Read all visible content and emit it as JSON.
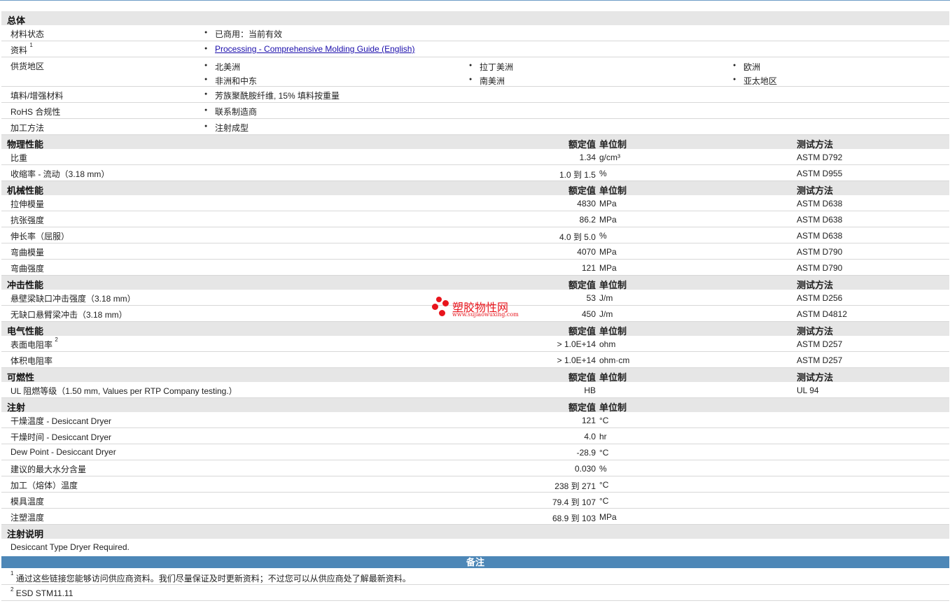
{
  "general": {
    "title": "总体",
    "material_status": {
      "label": "材料状态",
      "value": "已商用：当前有效"
    },
    "resources": {
      "label": "资料",
      "sup": "1",
      "link": "Processing - Comprehensive Molding Guide (English)"
    },
    "availability": {
      "label": "供货地区",
      "regions": [
        "北美洲",
        "拉丁美洲",
        "欧洲",
        "非洲和中东",
        "南美洲",
        "亚太地区"
      ]
    },
    "filler": {
      "label": "填料/增强材料",
      "value": "芳族聚酰胺纤维, 15% 填料按重量"
    },
    "rohs": {
      "label": "RoHS 合规性",
      "value": "联系制造商"
    },
    "processing": {
      "label": "加工方法",
      "value": "注射成型"
    }
  },
  "headers": {
    "value": "额定值",
    "unit": "单位制",
    "method": "测试方法"
  },
  "sections": [
    {
      "title": "物理性能",
      "show_method": true,
      "rows": [
        {
          "label": "比重",
          "value": "1.34",
          "unit": "g/cm³",
          "method": "ASTM D792"
        },
        {
          "label": "收缩率  - 流动（3.18 mm）",
          "value": "1.0 到  1.5",
          "unit": "%",
          "method": "ASTM D955"
        }
      ]
    },
    {
      "title": "机械性能",
      "show_method": true,
      "rows": [
        {
          "label": "拉伸模量",
          "value": "4830",
          "unit": "MPa",
          "method": "ASTM D638"
        },
        {
          "label": "抗张强度",
          "value": "86.2",
          "unit": "MPa",
          "method": "ASTM D638"
        },
        {
          "label": "伸长率（屈服）",
          "value": "4.0 到  5.0",
          "unit": "%",
          "method": "ASTM D638"
        },
        {
          "label": "弯曲模量",
          "value": "4070",
          "unit": "MPa",
          "method": "ASTM D790"
        },
        {
          "label": "弯曲强度",
          "value": "121",
          "unit": "MPa",
          "method": "ASTM D790"
        }
      ]
    },
    {
      "title": "冲击性能",
      "show_method": true,
      "rows": [
        {
          "label": "悬壁梁缺口冲击强度（3.18 mm）",
          "value": "53",
          "unit": "J/m",
          "method": "ASTM D256"
        },
        {
          "label": "无缺口悬臂梁冲击（3.18 mm）",
          "value": "450",
          "unit": "J/m",
          "method": "ASTM D4812"
        }
      ]
    },
    {
      "title": "电气性能",
      "show_method": true,
      "rows": [
        {
          "label": "表面电阻率",
          "sup": "2",
          "value": "> 1.0E+14",
          "unit": "ohm",
          "method": "ASTM D257"
        },
        {
          "label": "体积电阻率",
          "value": "> 1.0E+14",
          "unit": "ohm·cm",
          "method": "ASTM D257"
        }
      ]
    },
    {
      "title": "可燃性",
      "show_method": true,
      "rows": [
        {
          "label": "UL 阻燃等级（1.50 mm, Values per RTP Company testing.）",
          "value": "HB",
          "unit": "",
          "method": "UL 94"
        }
      ]
    },
    {
      "title": "注射",
      "show_method": false,
      "rows": [
        {
          "label": "干燥温度  - Desiccant Dryer",
          "value": "121",
          "unit": "°C",
          "method": ""
        },
        {
          "label": "干燥时间  - Desiccant Dryer",
          "value": "4.0",
          "unit": "hr",
          "method": ""
        },
        {
          "label": "Dew Point - Desiccant Dryer",
          "value": "-28.9",
          "unit": "°C",
          "method": ""
        },
        {
          "label": "建议的最大水分含量",
          "value": "0.030",
          "unit": "%",
          "method": ""
        },
        {
          "label": "加工（熔体）温度",
          "value": "238 到  271",
          "unit": "°C",
          "method": ""
        },
        {
          "label": "模具温度",
          "value": "79.4 到  107",
          "unit": "°C",
          "method": ""
        },
        {
          "label": "注塑温度",
          "value": "68.9 到  103",
          "unit": "MPa",
          "method": ""
        }
      ]
    }
  ],
  "injection_notes": {
    "title": "注射说明",
    "text": "Desiccant Type Dryer Required."
  },
  "notes": {
    "title": "备注",
    "items": [
      {
        "sup": "1",
        "text": "通过这些链接您能够访问供应商资料。我们尽量保证及时更新资料；不过您可以从供应商处了解最新资料。"
      },
      {
        "sup": "2",
        "text": "ESD STM11.11"
      }
    ]
  },
  "watermark": {
    "cn": "塑胶物性网",
    "en": "www.sujiaowuxing.com"
  }
}
